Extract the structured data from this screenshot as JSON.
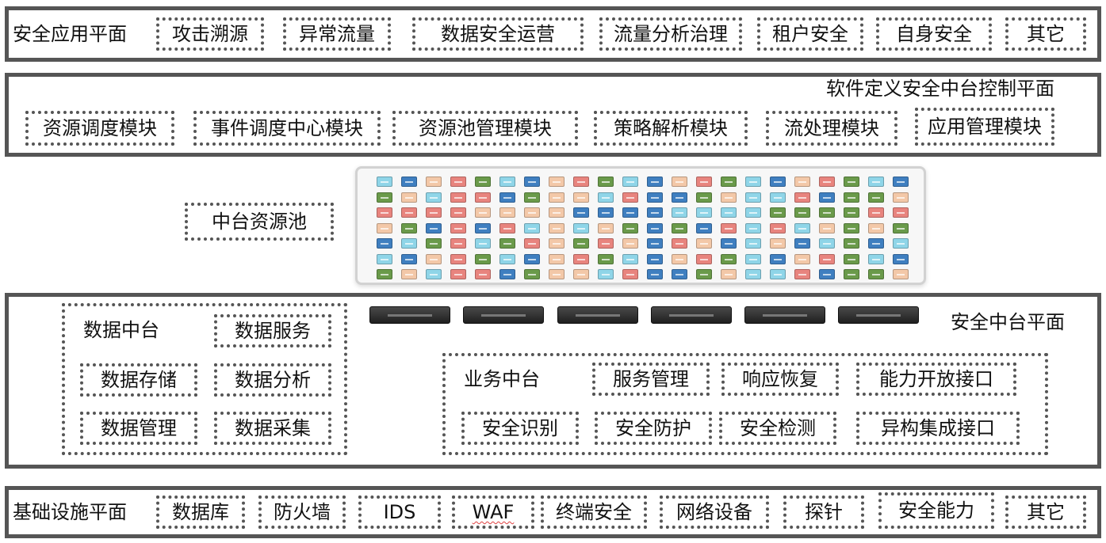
{
  "app_plane": {
    "title": "安全应用平面",
    "items": [
      "攻击溯源",
      "异常流量",
      "数据安全运营",
      "流量分析治理",
      "租户安全",
      "自身安全",
      "其它"
    ]
  },
  "control_plane": {
    "title": "软件定义安全中台控制平面",
    "items": [
      "资源调度模块",
      "事件调度中心模块",
      "资源池管理模块",
      "策略解析模块",
      "流处理模块",
      "应用管理模块"
    ]
  },
  "resource_pool": {
    "label": "中台资源池"
  },
  "platform_plane": {
    "title": "安全中台平面",
    "data_center": {
      "title": "数据中台",
      "items": [
        "数据服务",
        "数据存储",
        "数据分析",
        "数据管理",
        "数据采集"
      ]
    },
    "business_center": {
      "title": "业务中台",
      "items": [
        "服务管理",
        "响应恢复",
        "能力开放接口",
        "安全识别",
        "安全防护",
        "安全检测",
        "异构集成接口"
      ]
    }
  },
  "infra_plane": {
    "title": "基础设施平面",
    "items": [
      "数据库",
      "防火墙",
      "IDS",
      "WAF",
      "终端安全",
      "网络设备",
      "探针",
      "安全能力",
      "其它"
    ]
  },
  "colors": {
    "border": "#555555",
    "pool_red": "#e8847e",
    "pool_blue": "#3f7fc0",
    "pool_green": "#6a9a4a",
    "pool_cyan": "#8fd5e8",
    "pool_peach": "#f3c8a8"
  }
}
